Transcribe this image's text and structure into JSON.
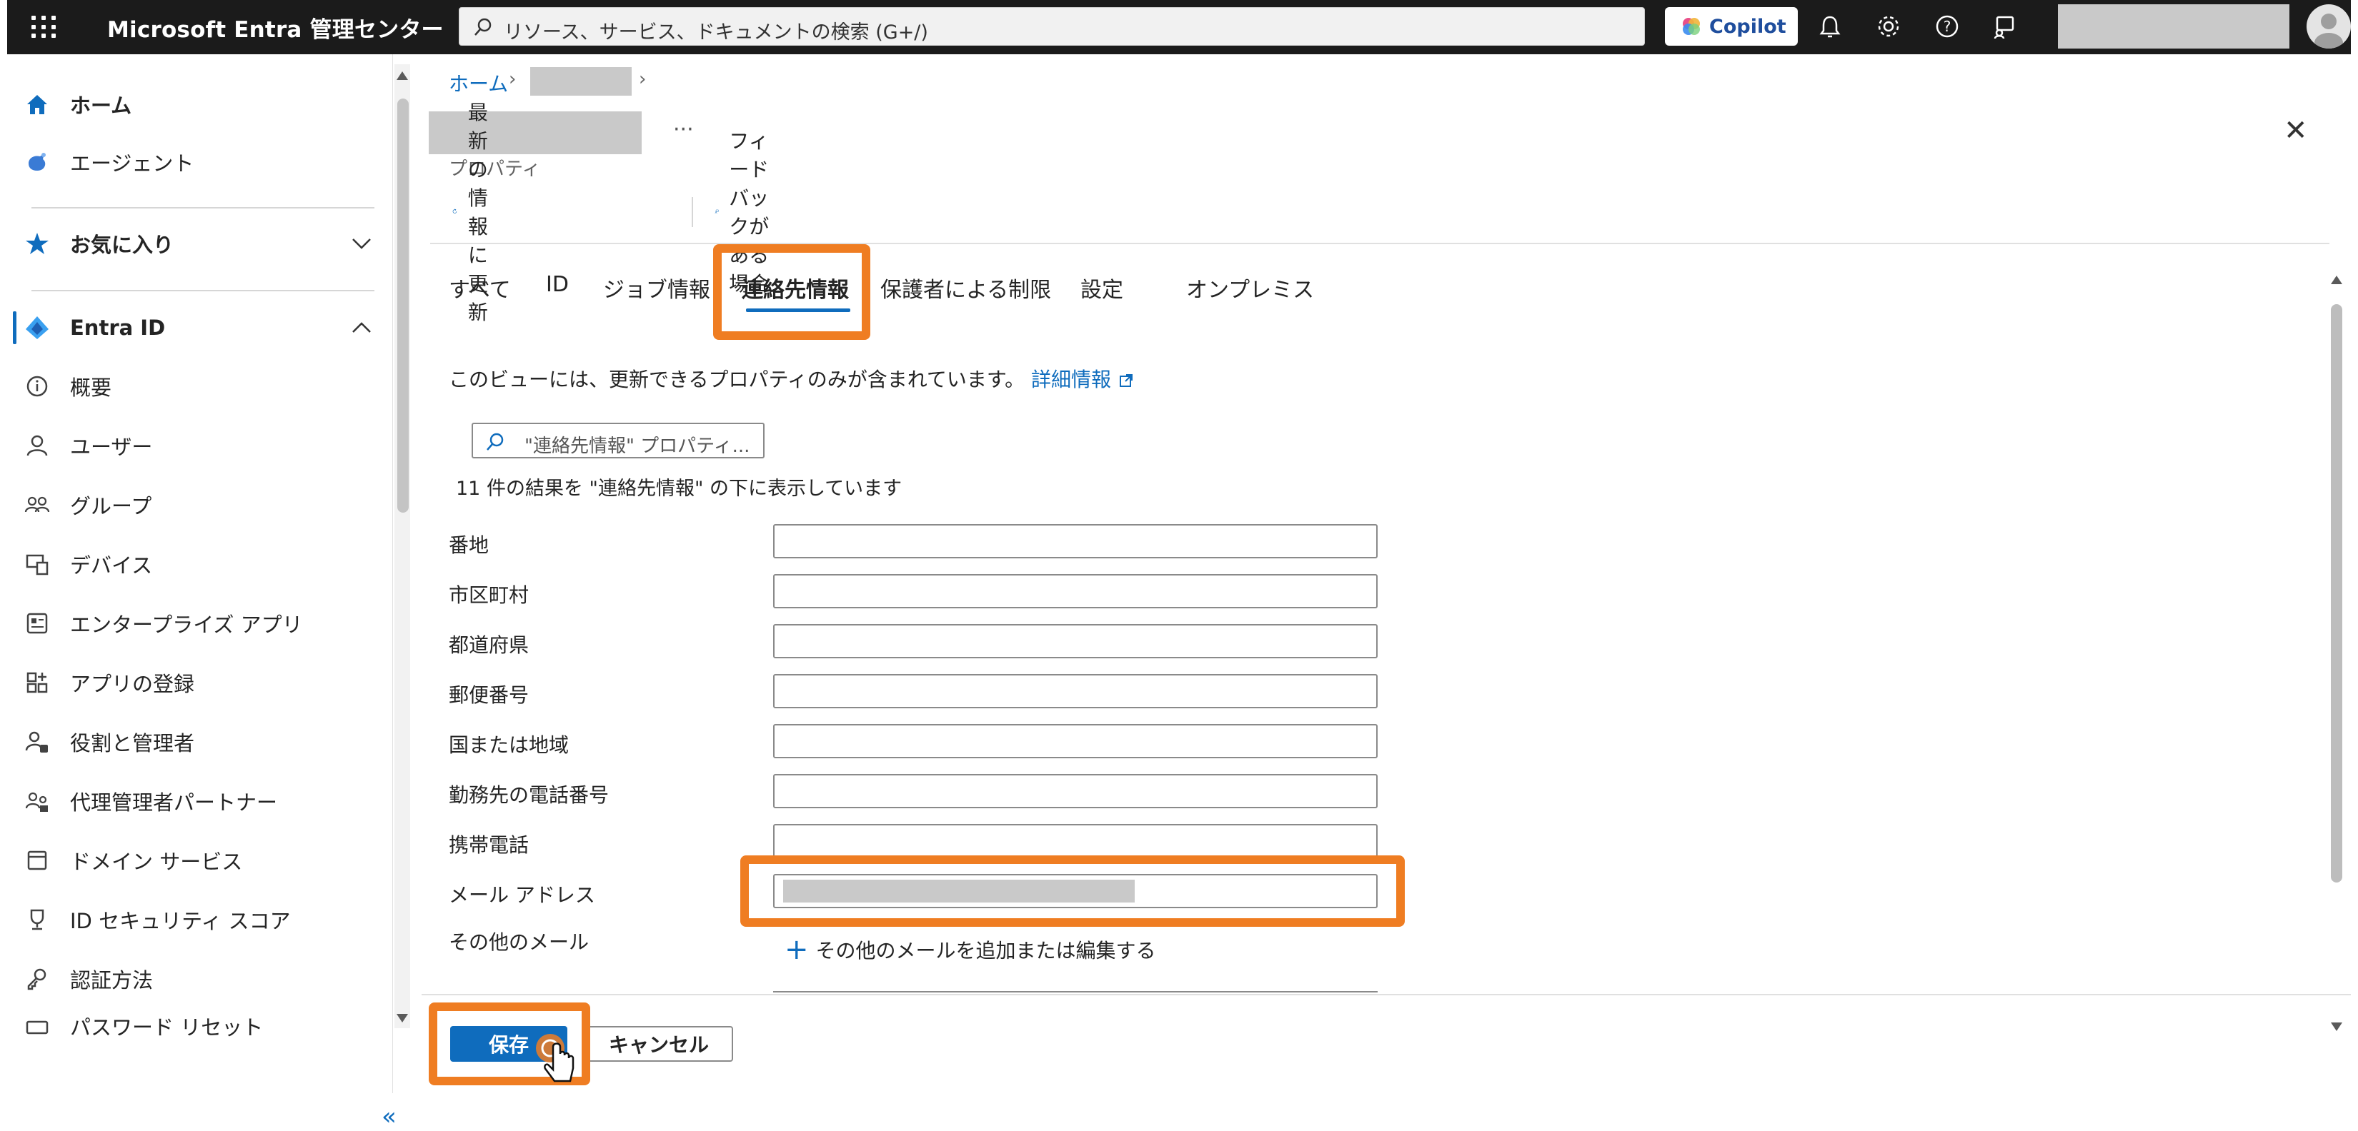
{
  "topbar": {
    "brand": "Microsoft Entra 管理センター",
    "search_placeholder": "リソース、サービス、ドキュメントの検索 (G+/)",
    "copilot_label": "Copilot"
  },
  "sidebar": {
    "home": "ホーム",
    "agent": "エージェント",
    "favorites": "お気に入り",
    "entra_id": "Entra ID",
    "items": [
      {
        "label": "概要",
        "icon": "info-icon"
      },
      {
        "label": "ユーザー",
        "icon": "user-icon"
      },
      {
        "label": "グループ",
        "icon": "group-icon"
      },
      {
        "label": "デバイス",
        "icon": "device-icon"
      },
      {
        "label": "エンタープライズ アプリ",
        "icon": "enterprise-app-icon"
      },
      {
        "label": "アプリの登録",
        "icon": "app-registration-icon"
      },
      {
        "label": "役割と管理者",
        "icon": "roles-icon"
      },
      {
        "label": "代理管理者パートナー",
        "icon": "partner-icon"
      },
      {
        "label": "ドメイン サービス",
        "icon": "domain-icon"
      },
      {
        "label": "ID セキュリティ スコア",
        "icon": "trophy-icon"
      },
      {
        "label": "認証方法",
        "icon": "auth-method-icon"
      },
      {
        "label": "パスワード リセット",
        "icon": "password-icon"
      }
    ],
    "collapse": "«"
  },
  "main": {
    "breadcrumb_home": "ホーム",
    "subtitle": "プロパティ",
    "ellipsis": "···",
    "close": "✕",
    "commands": {
      "refresh": "最新の情報に更新",
      "feedback": "フィードバックがある場合"
    },
    "tabs": [
      {
        "label": "すべて"
      },
      {
        "label": "ID"
      },
      {
        "label": "ジョブ情報"
      },
      {
        "label": "連絡先情報"
      },
      {
        "label": "保護者による制限"
      },
      {
        "label": "設定"
      },
      {
        "label": "オンプレミス"
      }
    ],
    "info_text": "このビューには、更新できるプロパティのみが含まれています。",
    "info_link": "詳細情報",
    "filter_placeholder": "\"連絡先情報\" プロパティ...",
    "result_count": "11 件の結果を \"連絡先情報\" の下に表示しています",
    "fields": [
      {
        "label": "番地",
        "value": ""
      },
      {
        "label": "市区町村",
        "value": ""
      },
      {
        "label": "都道府県",
        "value": ""
      },
      {
        "label": "郵便番号",
        "value": ""
      },
      {
        "label": "国または地域",
        "value": ""
      },
      {
        "label": "勤務先の電話番号",
        "value": ""
      },
      {
        "label": "携帯電話",
        "value": ""
      },
      {
        "label": "メール アドレス",
        "value": ""
      }
    ],
    "other_email_label": "その他のメール",
    "add_email": "その他のメールを追加または編集する",
    "save": "保存",
    "cancel": "キャンセル"
  },
  "colors": {
    "accent": "#0f6cbd",
    "highlight": "#ef7d22",
    "topbar": "#1b1b1b"
  }
}
